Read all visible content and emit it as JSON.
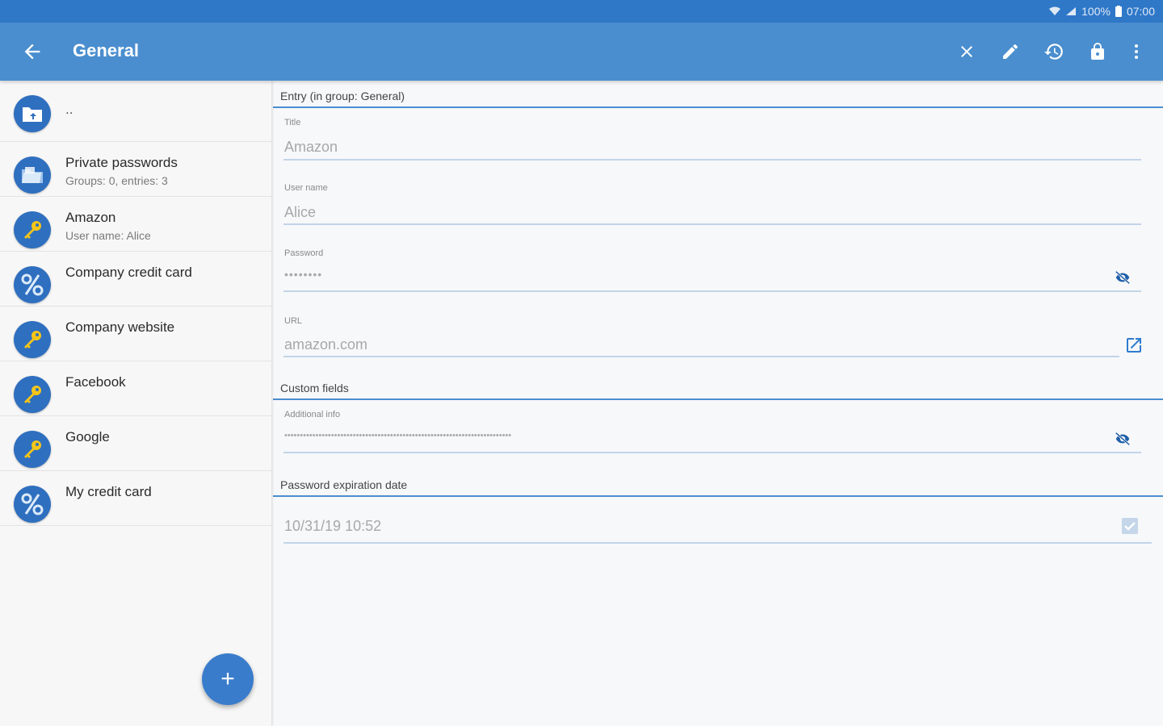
{
  "status_bar": {
    "battery": "100%",
    "time": "07:00"
  },
  "app_bar": {
    "title": "General",
    "icons": {
      "back": "arrow-left-icon",
      "close": "close-icon",
      "edit": "pencil-icon",
      "history": "history-icon",
      "lock": "lock-icon",
      "more": "more-vert-icon"
    }
  },
  "list": {
    "parent": {
      "label": "..",
      "icon": "folder-up-icon"
    },
    "items": [
      {
        "title": "Private passwords",
        "subtitle": "Groups: 0, entries: 3",
        "icon": "folder-icon"
      },
      {
        "title": "Amazon",
        "subtitle": "User name: Alice",
        "icon": "key-icon"
      },
      {
        "title": "Company credit card",
        "subtitle": "",
        "icon": "percent-icon"
      },
      {
        "title": "Company website",
        "subtitle": "",
        "icon": "key-icon"
      },
      {
        "title": "Facebook",
        "subtitle": "",
        "icon": "key-icon"
      },
      {
        "title": "Google",
        "subtitle": "",
        "icon": "key-icon"
      },
      {
        "title": "My credit card",
        "subtitle": "",
        "icon": "percent-icon"
      }
    ],
    "fab_label": "+"
  },
  "entry": {
    "section_title": "Entry (in group: General)",
    "title_label": "Title",
    "title_value": "Amazon",
    "username_label": "User name",
    "username_value": "Alice",
    "password_label": "Password",
    "password_value": "••••••••",
    "url_label": "URL",
    "url_value": "amazon.com"
  },
  "custom_fields": {
    "section_title": "Custom fields",
    "additional_label": "Additional info",
    "additional_value": "•••••••••••••••••••••••••••••••••••••••••••••••••••••••••••••••••••••••••"
  },
  "expiration": {
    "section_title": "Password expiration date",
    "date_value": "10/31/19 10:52",
    "checked": true
  },
  "colors": {
    "status_bar": "#2f78c8",
    "app_bar": "#4a8ecf",
    "accent": "#2f6fbf",
    "key_yellow": "#f5c518"
  }
}
